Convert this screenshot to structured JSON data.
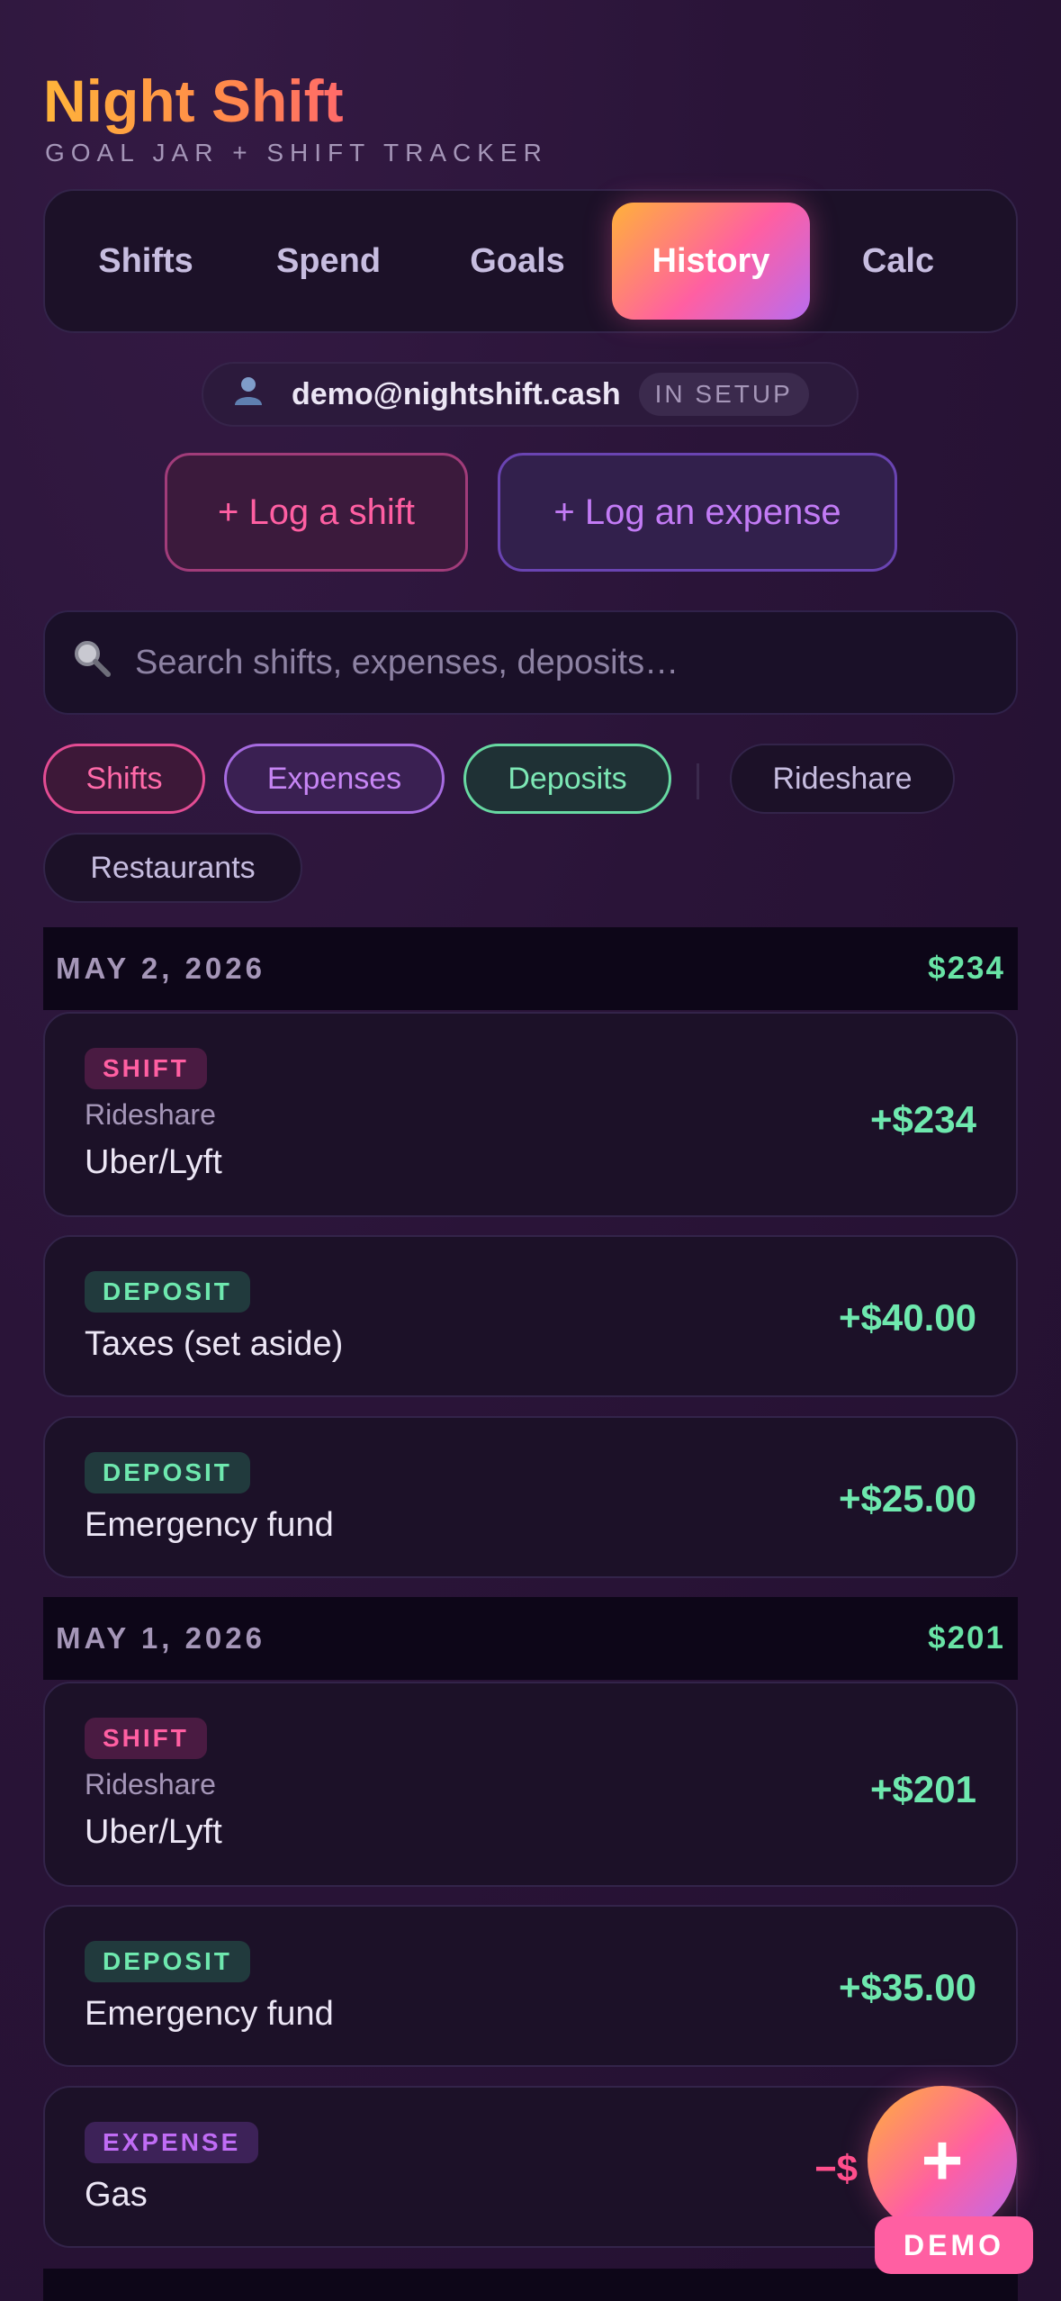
{
  "app": {
    "title": "Night Shift",
    "subtitle": "GOAL JAR + SHIFT TRACKER"
  },
  "tabs": [
    {
      "label": "Shifts",
      "active": false
    },
    {
      "label": "Spend",
      "active": false
    },
    {
      "label": "Goals",
      "active": false
    },
    {
      "label": "History",
      "active": true
    },
    {
      "label": "Calc",
      "active": false
    }
  ],
  "user": {
    "icon": "user-icon",
    "email": "demo@nightshift.cash",
    "status": "IN SETUP"
  },
  "actions": {
    "log_shift": "+ Log a shift",
    "log_expense": "+ Log an expense"
  },
  "search": {
    "icon": "search-icon",
    "placeholder": "Search shifts, expenses, deposits…"
  },
  "filters": [
    {
      "label": "Shifts",
      "active": true
    },
    {
      "label": "Expenses",
      "active": true
    },
    {
      "label": "Deposits",
      "active": true
    },
    {
      "label": "Rideshare",
      "active": false
    },
    {
      "label": "Restaurants",
      "active": false
    }
  ],
  "history": [
    {
      "date": "MAY 2, 2026",
      "total": "$234",
      "entries": [
        {
          "type": "SHIFT",
          "category": "Rideshare",
          "title": "Uber/Lyft",
          "amount": "+$234"
        },
        {
          "type": "DEPOSIT",
          "title": "Taxes (set aside)",
          "amount": "+$40.00"
        },
        {
          "type": "DEPOSIT",
          "title": "Emergency fund",
          "amount": "+$25.00"
        }
      ]
    },
    {
      "date": "MAY 1, 2026",
      "total": "$201",
      "entries": [
        {
          "type": "SHIFT",
          "category": "Rideshare",
          "title": "Uber/Lyft",
          "amount": "+$201"
        },
        {
          "type": "DEPOSIT",
          "title": "Emergency fund",
          "amount": "+$35.00"
        },
        {
          "type": "EXPENSE",
          "title": "Gas",
          "amount": "−$"
        }
      ]
    }
  ],
  "fab": {
    "label": "+",
    "icon": "plus-icon"
  },
  "demo_badge": "DEMO",
  "colors": {
    "accent_pink": "#ff5fa2",
    "accent_orange": "#ffb13a",
    "accent_purple": "#b86cf0",
    "positive": "#6ee8ae",
    "background": "#2a1438"
  }
}
